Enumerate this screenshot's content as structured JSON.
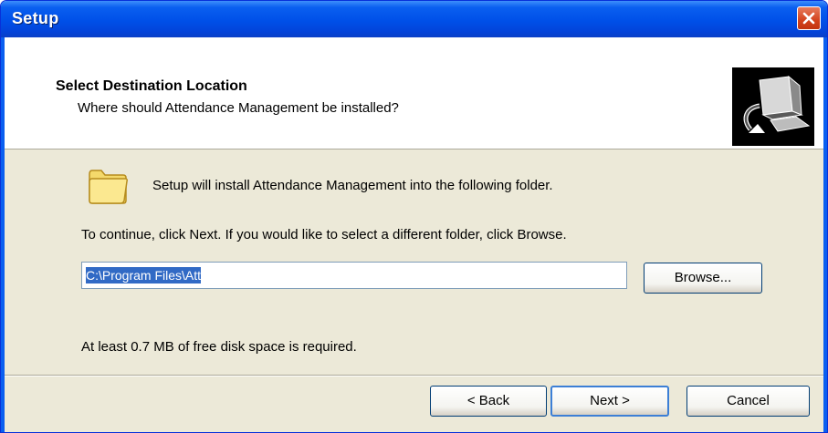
{
  "window": {
    "title": "Setup",
    "close_icon": "close-icon"
  },
  "header": {
    "title": "Select Destination Location",
    "subtitle": "Where should Attendance Management be installed?",
    "image_icon": "computer-install-icon"
  },
  "content": {
    "folder_icon": "folder-icon",
    "install_text": "Setup will install Attendance Management into the following folder.",
    "continue_text": "To continue, click Next. If you would like to select a different folder, click Browse.",
    "path_value": "C:\\Program Files\\Att",
    "browse_label": "Browse...",
    "space_text": "At least 0.7 MB of free disk space is required."
  },
  "footer": {
    "back_label": "< Back",
    "next_label": "Next >",
    "cancel_label": "Cancel"
  },
  "colors": {
    "titlebar": "#0a5ff0",
    "selection": "#316ac5",
    "dialog_bg": "#ece9d8",
    "close_button": "#d3431d"
  }
}
